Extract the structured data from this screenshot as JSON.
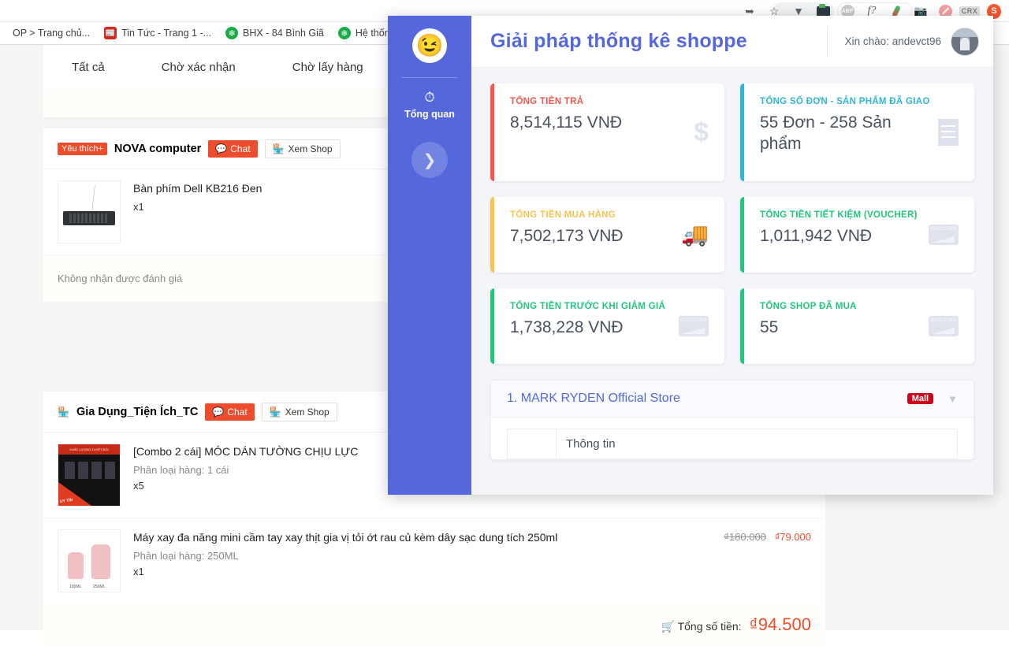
{
  "browser": {
    "toolbar_icons": [
      "share-icon",
      "bookmark-star-icon",
      "vdownloader-icon",
      "video-capture-icon",
      "adblock-icon",
      "flash-icon",
      "feather-icon",
      "camera-icon",
      "no-script-icon",
      "crx-icon",
      "shopee-extension-icon"
    ],
    "bookmarks": [
      {
        "label": "OP > Trang chủ...",
        "favicon": "none"
      },
      {
        "label": "Tin Tức - Trang 1 -...",
        "favicon": "red"
      },
      {
        "label": "BHX - 84 Bình Giã",
        "favicon": "green"
      },
      {
        "label": "Hệ thống cửa hà",
        "favicon": "green"
      }
    ]
  },
  "shopee": {
    "tabs": [
      "Tất cả",
      "Chờ xác nhận",
      "Chờ lấy hàng"
    ],
    "orders": [
      {
        "shop": "NOVA computer",
        "favorite_badge": "Yêu thích+",
        "chat_label": "Chat",
        "view_shop_label": "Xem Shop",
        "products": [
          {
            "title": "Bàn phím Dell KB216 Đen",
            "variant": "",
            "qty": "x1",
            "old_price": "",
            "new_price": "",
            "thumb": "keyboard"
          }
        ],
        "review_note": "Không nhận được đánh giá"
      },
      {
        "shop": "Gia Dụng_Tiện Ích_TC",
        "favorite_badge": "",
        "chat_label": "Chat",
        "view_shop_label": "Xem Shop",
        "products": [
          {
            "title": "[Combo 2 cái] MÓC DÁN TƯỜNG CHỊU LỰC",
            "variant": "Phân loại hàng: 1 cái",
            "qty": "x5",
            "old_price": "",
            "new_price": "",
            "thumb": "hook"
          },
          {
            "title": "Máy xay đa năng mini cầm tay xay thịt gia vị tỏi ớt rau củ kèm dây sạc dung tích 250ml",
            "variant": "Phân loại hàng: 250ML",
            "qty": "x1",
            "old_price": "₫180.000",
            "new_price": "₫79.000",
            "thumb": "blender"
          }
        ],
        "total_label": "Tổng số tiền:",
        "total_amount": "₫94.500"
      }
    ]
  },
  "app": {
    "title": "Giải pháp thống kê shoppe",
    "greeting": "Xin chào: andevct96",
    "sidebar": {
      "logo_icon": "wink-face-icon",
      "items": [
        {
          "label": "Tổng quan",
          "icon": "dashboard-gauge-icon",
          "active": true
        }
      ],
      "next_button_icon": "chevron-right-icon"
    },
    "stats": [
      {
        "label": "TỔNG TIỀN TRẢ",
        "value": "8,514,115 VNĐ",
        "color": "#f2584d",
        "icon": "dollar-icon",
        "size": "tall"
      },
      {
        "label": "TỔNG SỐ ĐƠN - SẢN PHẨM ĐÃ GIAO",
        "value": "55 Đơn - 258 Sản phẩm",
        "color": "#2eb6d4",
        "icon": "receipt-icon",
        "size": "tall"
      },
      {
        "label": "TỔNG TIỀN MUA HÀNG",
        "value": "7,502,173 VNĐ",
        "color": "#f5c451",
        "icon": "truck-icon",
        "size": "short"
      },
      {
        "label": "TỔNG TIỀN TIẾT KIỆM (VOUCHER)",
        "value": "1,011,942 VNĐ",
        "color": "#22c67e",
        "icon": "credit-card-icon",
        "size": "short"
      },
      {
        "label": "TỔNG TIỀN TRƯỚC KHI GIẢM GIÁ",
        "value": "1,738,228 VNĐ",
        "color": "#22c67e",
        "icon": "credit-card-icon",
        "size": "short"
      },
      {
        "label": "TỔNG SHOP ĐÃ MUA",
        "value": "55",
        "color": "#22c67e",
        "icon": "credit-card-icon",
        "size": "short"
      }
    ],
    "shop_panel": {
      "title": "1. MARK RYDEN Official Store",
      "mall_badge": "Mall",
      "chevron_icon": "chevron-down-icon",
      "table_headers": [
        "",
        "Thông tin"
      ]
    }
  }
}
